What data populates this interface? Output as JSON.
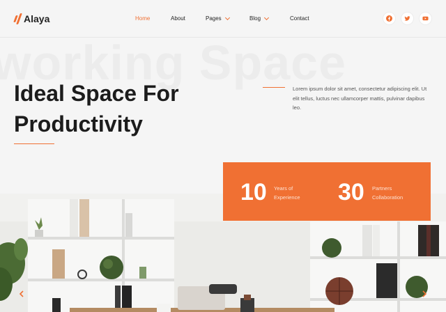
{
  "brand": {
    "name": "Alaya"
  },
  "nav": {
    "items": [
      {
        "label": "Home",
        "active": true,
        "dropdown": false
      },
      {
        "label": "About",
        "active": false,
        "dropdown": false
      },
      {
        "label": "Pages",
        "active": false,
        "dropdown": true
      },
      {
        "label": "Blog",
        "active": false,
        "dropdown": true
      },
      {
        "label": "Contact",
        "active": false,
        "dropdown": false
      }
    ]
  },
  "social": [
    {
      "icon": "facebook-icon"
    },
    {
      "icon": "twitter-icon"
    },
    {
      "icon": "youtube-icon"
    }
  ],
  "hero": {
    "watermark": "working Space",
    "title_line1": "Ideal Space For",
    "title_line2": "Productivity",
    "description": "Lorem ipsum dolor sit amet, consectetur adipiscing elit. Ut elit tellus, luctus nec ullamcorper mattis, pulvinar dapibus leo."
  },
  "stats": [
    {
      "value": "10",
      "label_line1": "Years of",
      "label_line2": "Experience"
    },
    {
      "value": "30",
      "label_line1": "Partners",
      "label_line2": "Collaboration"
    }
  ],
  "colors": {
    "accent": "#f07033",
    "background": "#f5f5f5",
    "text": "#1e1e1e"
  },
  "slider": {
    "prev_icon": "chevron-left-icon",
    "next_icon": "chevron-right-icon"
  }
}
